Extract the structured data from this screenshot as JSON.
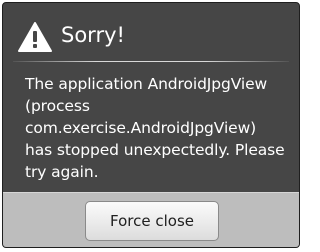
{
  "dialog": {
    "title": "Sorry!",
    "icon": "warning-icon",
    "message": "The application AndroidJpgView (process com.exercise.AndroidJpgView) has stopped unexpectedly. Please try again.",
    "force_close_label": "Force close"
  },
  "colors": {
    "dialog_background": "#464646",
    "button_bar_background": "#bdbdbd",
    "text": "#ffffff"
  }
}
